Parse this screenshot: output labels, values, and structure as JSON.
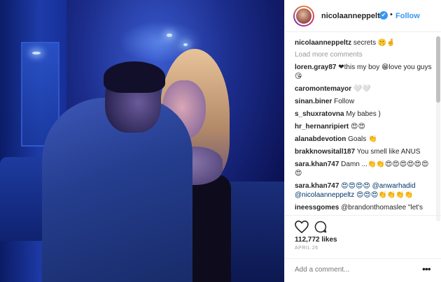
{
  "post": {
    "username": "nicolaanneppeltz",
    "follow_label": "Follow",
    "dot": "•",
    "verified_glyph": "✔",
    "caption_user": "nicolaanneppeltz",
    "caption_text": "secrets 🤫🤞"
  },
  "comments": {
    "load_more": "Load more comments",
    "items": [
      {
        "user": "loren.gray87",
        "text": "❤this my boy 😁love you guys 😘"
      },
      {
        "user": "caromontemayor",
        "text": "🤍🤍"
      },
      {
        "user": "sinan.biner",
        "text": "Follow"
      },
      {
        "user": "s_shuxratovna",
        "text": "My babes )"
      },
      {
        "user": "hr_hernanripiert",
        "text": "😍😍"
      },
      {
        "user": "alanabdevotion",
        "text": "Goals 👏"
      },
      {
        "user": "brakknowsitall187",
        "text": "You smell like ANUS"
      },
      {
        "user": "sara.khan747",
        "text": "Damn ...👏👏😍😍😍😍😍😍😍"
      },
      {
        "user": "sara.khan747",
        "text": "😍😍😍😍 @anwarhadid @nicolaanneppeltz 😍😍😍👏👏👏👏"
      },
      {
        "user": "ineessgomes",
        "text": "@brandonthomaslee \"let's get some pizza\""
      }
    ]
  },
  "stats": {
    "likes": "112,772 likes",
    "date": "APRIL 26"
  },
  "add_comment": {
    "placeholder": "Add a comment...",
    "more": "•••"
  },
  "icons": {
    "heart": "heart-icon",
    "comment": "comment-icon",
    "verified": "verified-badge-icon"
  },
  "colors": {
    "accent": "#3897f0",
    "text": "#262626",
    "muted": "#999999"
  }
}
